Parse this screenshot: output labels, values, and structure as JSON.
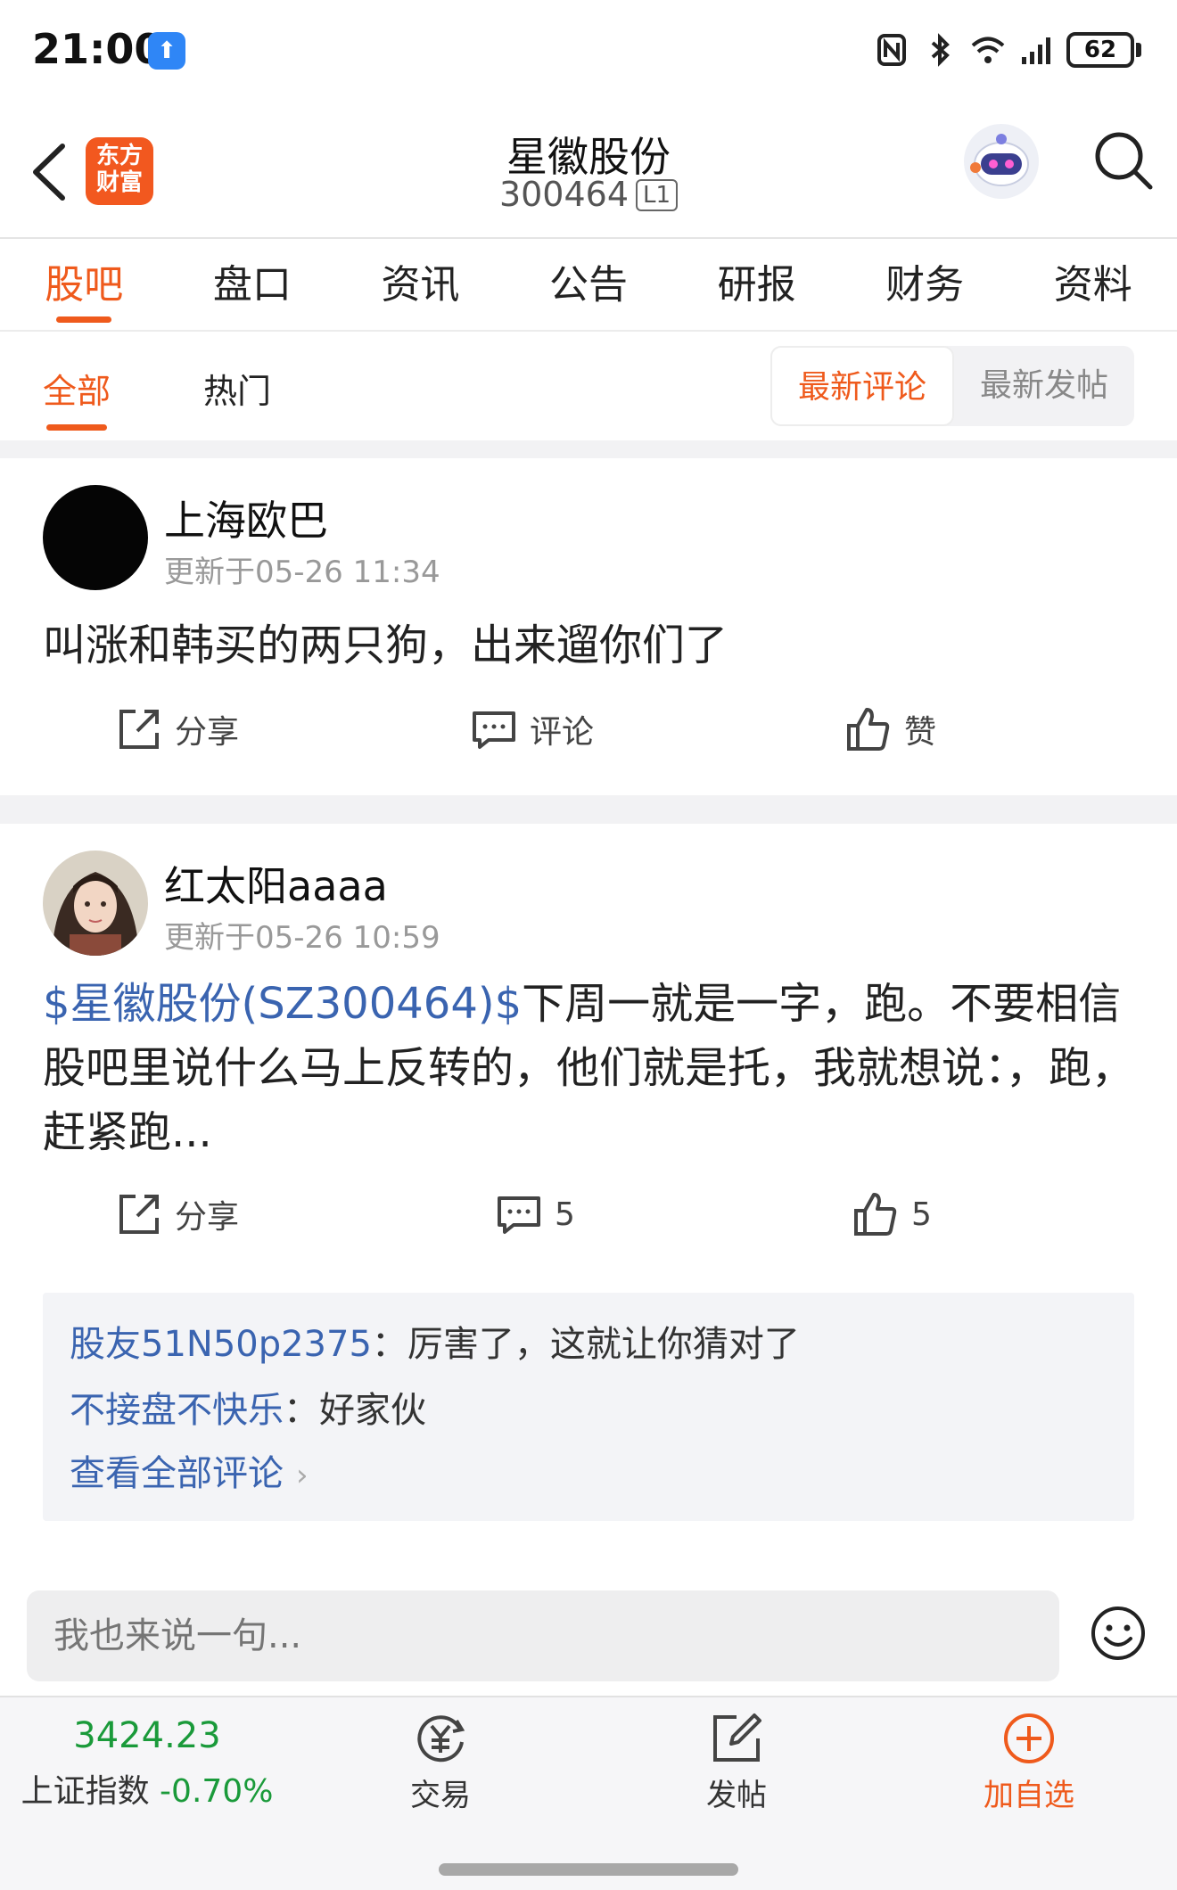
{
  "status_bar": {
    "time": "21:00",
    "battery": "62",
    "icons": [
      "nfc-icon",
      "bluetooth-icon",
      "wifi-icon",
      "signal-icon"
    ]
  },
  "header": {
    "app_logo_line1": "东方",
    "app_logo_line2": "财富",
    "title": "星徽股份",
    "stock_code": "300464",
    "level": "L1"
  },
  "main_tabs": [
    {
      "label": "股吧",
      "active": true
    },
    {
      "label": "盘口"
    },
    {
      "label": "资讯"
    },
    {
      "label": "公告"
    },
    {
      "label": "研报"
    },
    {
      "label": "财务"
    },
    {
      "label": "资料"
    }
  ],
  "sub_tabs": {
    "all": "全部",
    "hot": "热门",
    "sort_latest_comment": "最新评论",
    "sort_latest_post": "最新发帖"
  },
  "posts": [
    {
      "author": "上海欧巴",
      "time": "更新于05-26 11:34",
      "text": "叫涨和韩买的两只狗，出来遛你们了",
      "share": "分享",
      "comment": "评论",
      "like": "赞"
    },
    {
      "author": "红太阳aaaa",
      "time": "更新于05-26 10:59",
      "stock_link": "$星徽股份(SZ300464)$",
      "text": "下周一就是一字，跑。不要相信股吧里说什么马上反转的，他们就是托，我就想说：，跑，赶紧跑...",
      "share": "分享",
      "comment_count": "5",
      "like_count": "5",
      "comments": [
        {
          "user": "股友51N50p2375",
          "sep": "：",
          "text": "厉害了，这就让你猜对了"
        },
        {
          "user": "不接盘不快乐",
          "sep": "：",
          "text": "好家伙"
        }
      ],
      "view_all": "查看全部评论"
    }
  ],
  "comment_input": {
    "placeholder": "我也来说一句..."
  },
  "bottom_nav": {
    "index_value": "3424.23",
    "index_name": "上证指数",
    "index_change": "-0.70%",
    "trade": "交易",
    "post": "发帖",
    "add_watch": "加自选"
  },
  "colors": {
    "accent": "#ef5a1c",
    "link": "#3a64b0",
    "down": "#1a9a3a"
  }
}
